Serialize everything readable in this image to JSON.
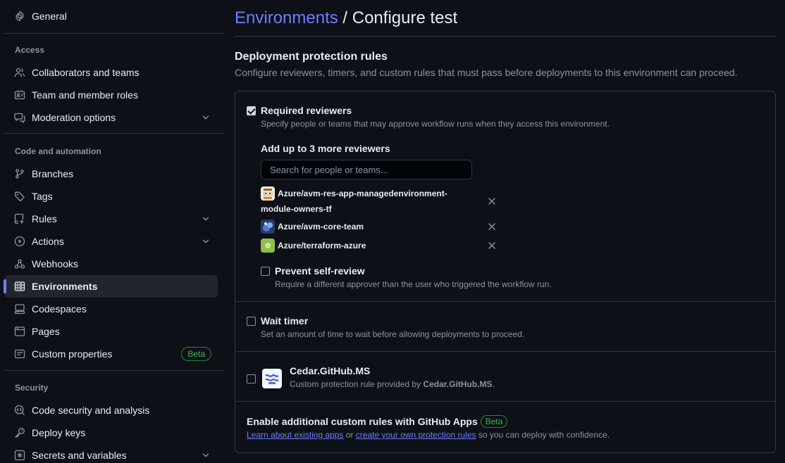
{
  "sidebar": {
    "general": "General",
    "access_title": "Access",
    "access": [
      "Collaborators and teams",
      "Team and member roles",
      "Moderation options"
    ],
    "code_title": "Code and automation",
    "code": [
      "Branches",
      "Tags",
      "Rules",
      "Actions",
      "Webhooks",
      "Environments",
      "Codespaces",
      "Pages",
      "Custom properties"
    ],
    "beta": "Beta",
    "security_title": "Security",
    "security": [
      "Code security and analysis",
      "Deploy keys",
      "Secrets and variables"
    ]
  },
  "breadcrumb": {
    "link": "Environments",
    "sep": "/",
    "current": "Configure test"
  },
  "protection": {
    "title": "Deployment protection rules",
    "description": "Configure reviewers, timers, and custom rules that must pass before deployments to this environment can proceed.",
    "required_reviewers": {
      "checked": true,
      "title": "Required reviewers",
      "description": "Specify people or teams that may approve workflow runs when they access this environment.",
      "add_title": "Add up to 3 more reviewers",
      "search_placeholder": "Search for people or teams...",
      "reviewers": [
        {
          "line1": "Azure/avm-res-app-managedenvironment-",
          "line2": "module-owners-tf"
        },
        {
          "line1": "Azure/avm-core-team"
        },
        {
          "line1": "Azure/terraform-azure"
        }
      ],
      "prevent_self_review": {
        "checked": false,
        "title": "Prevent self-review",
        "description": "Require a different approver than the user who triggered the workflow run."
      }
    },
    "wait_timer": {
      "checked": false,
      "title": "Wait timer",
      "description": "Set an amount of time to wait before allowing deployments to proceed."
    },
    "custom_app": {
      "checked": false,
      "title": "Cedar.GitHub.MS",
      "desc_prefix": "Custom protection rule provided by ",
      "desc_app": "Cedar.GitHub.MS",
      "desc_suffix": "."
    },
    "footer": {
      "title": "Enable additional custom rules with GitHub Apps",
      "beta": "Beta",
      "link1": "Learn about existing apps",
      "mid": " or ",
      "link2": "create your own protection rules",
      "suffix": " so you can deploy with confidence."
    }
  },
  "colors": {
    "background": "#0d1117",
    "accent": "#6e7dff",
    "border": "#30363d",
    "muted": "#8b949e",
    "beta_green": "#3fb950"
  }
}
